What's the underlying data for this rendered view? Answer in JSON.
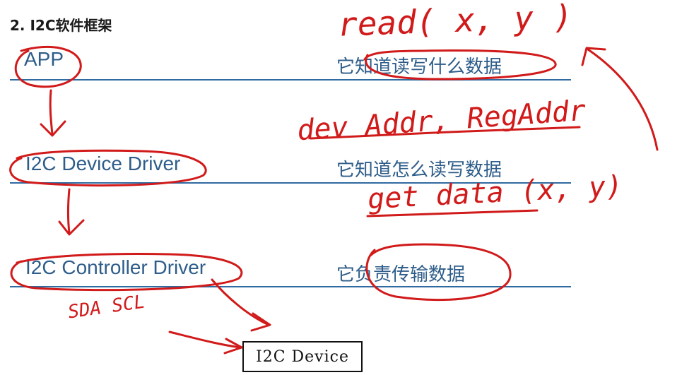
{
  "heading": "2. I2C软件框架",
  "layers": [
    {
      "name": "APP",
      "description": "它知道读写什么数据"
    },
    {
      "name": "I2C Device Driver",
      "description": "它知道怎么读写数据"
    },
    {
      "name": "I2C Controller Driver",
      "description": "它负责传输数据"
    }
  ],
  "device": "I2C Device",
  "annotations": {
    "read_call": "read( x, y )",
    "address_note": "dev Addr, RegAddr",
    "get_data": "get data (x, y)",
    "bus_signals": "SDA SCL"
  },
  "colors": {
    "layer_text": "#2e5d8a",
    "rule_line": "#2f6aa0",
    "ink": "#d11a1a"
  }
}
